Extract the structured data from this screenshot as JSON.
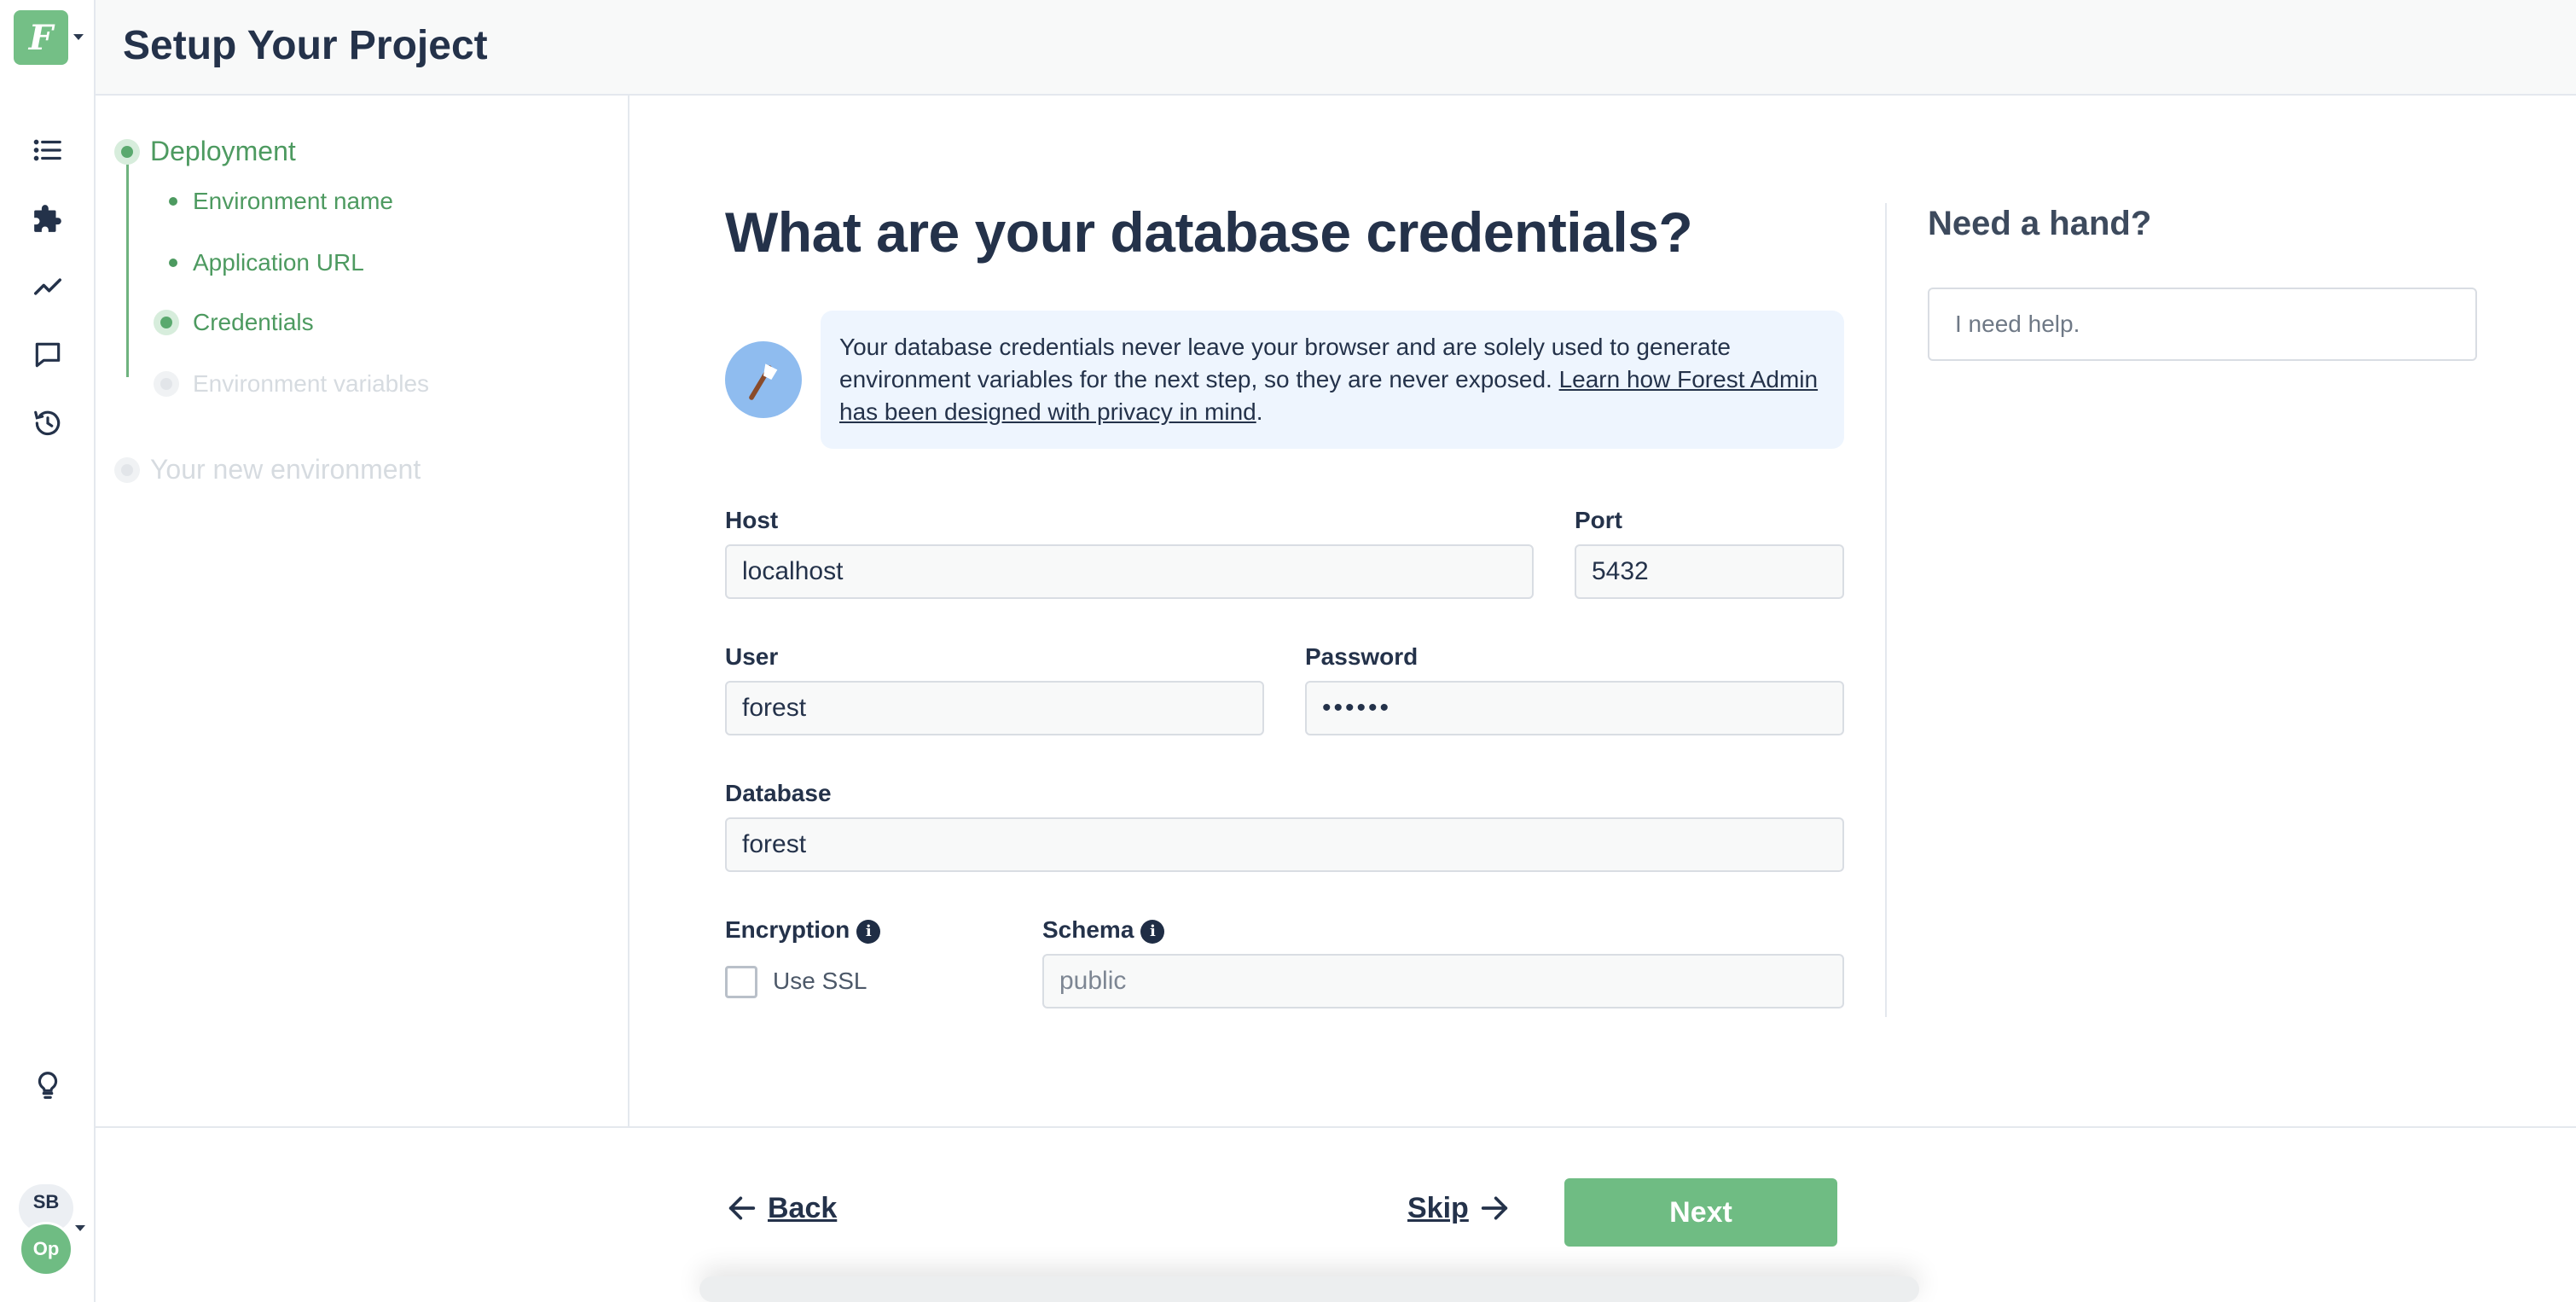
{
  "app": {
    "logo_letter": "F",
    "page_title": "Setup Your Project"
  },
  "rail": {
    "icons": [
      "list-icon",
      "puzzle-icon",
      "chart-line-icon",
      "chat-icon",
      "history-icon",
      "lightbulb-icon"
    ],
    "user_initials": "SB",
    "project_initials": "Op"
  },
  "steps": {
    "deployment": "Deployment",
    "environment_name": "Environment name",
    "application_url": "Application URL",
    "credentials": "Credentials",
    "environment_variables": "Environment variables",
    "new_environment": "Your new environment"
  },
  "form": {
    "title": "What are your database credentials?",
    "info_text": "Your database credentials never leave your browser and are solely used to generate environment variables for the next step, so they are never exposed.",
    "info_link": "Learn how Forest Admin has been designed with privacy in mind",
    "host_label": "Host",
    "host_value": "localhost",
    "port_label": "Port",
    "port_value": "5432",
    "user_label": "User",
    "user_value": "forest",
    "password_label": "Password",
    "password_value": "••••••",
    "database_label": "Database",
    "database_value": "forest",
    "encryption_label": "Encryption",
    "ssl_label": "Use SSL",
    "schema_label": "Schema",
    "schema_placeholder": "public"
  },
  "help": {
    "title": "Need a hand?",
    "placeholder": "I need help."
  },
  "footer": {
    "back": "Back",
    "skip": "Skip",
    "next": "Next"
  },
  "colors": {
    "accent_green": "#6fbc83",
    "info_blue": "#eef5fe",
    "text_dark": "#24324a"
  }
}
